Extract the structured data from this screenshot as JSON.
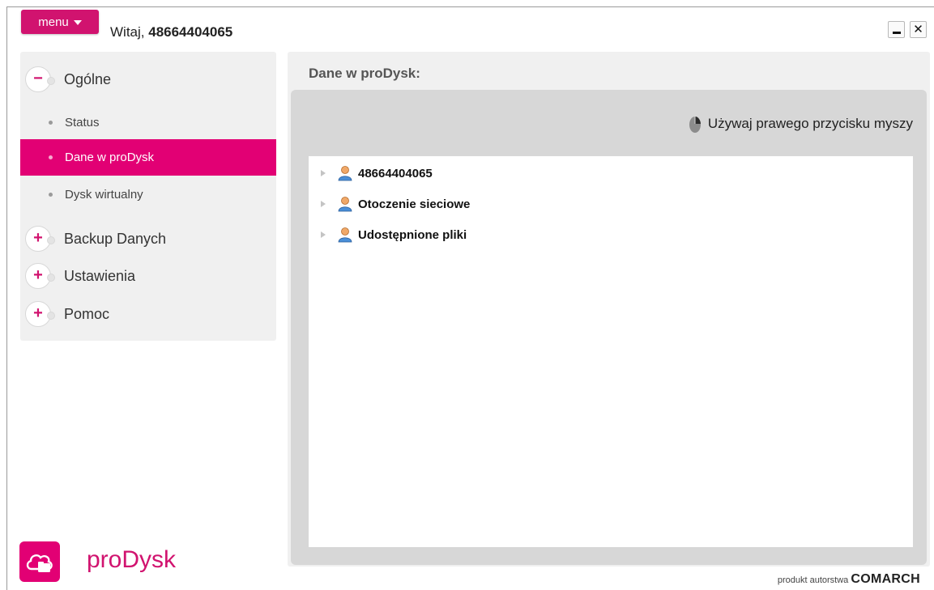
{
  "header": {
    "menu_label": "menu",
    "greeting_prefix": "Witaj, ",
    "user_number": "48664404065"
  },
  "sidebar": {
    "sections": [
      {
        "label": "Ogólne",
        "expanded": true,
        "toggle": "−"
      },
      {
        "label": "Backup Danych",
        "expanded": false,
        "toggle": "+"
      },
      {
        "label": "Ustawienia",
        "expanded": false,
        "toggle": "+"
      },
      {
        "label": "Pomoc",
        "expanded": false,
        "toggle": "+"
      }
    ],
    "sub_items": [
      {
        "label": "Status",
        "active": false
      },
      {
        "label": "Dane w proDysk",
        "active": true
      },
      {
        "label": "Dysk wirtualny",
        "active": false
      }
    ]
  },
  "content": {
    "title": "Dane w proDysk:",
    "hint": "Używaj prawego przycisku myszy",
    "tree": [
      {
        "label": "48664404065",
        "icon": "user-icon"
      },
      {
        "label": "Otoczenie sieciowe",
        "icon": "user-icon"
      },
      {
        "label": "Udostępnione pliki",
        "icon": "user-icon"
      }
    ]
  },
  "branding": {
    "product_name": "proDysk",
    "credit_prefix": "produkt autorstwa ",
    "company": "COMARCH"
  },
  "colors": {
    "accent": "#e20074",
    "accent_dark": "#d1136f",
    "panel_bg": "#f0f0f0",
    "panel_inner": "#d7d7d7"
  }
}
